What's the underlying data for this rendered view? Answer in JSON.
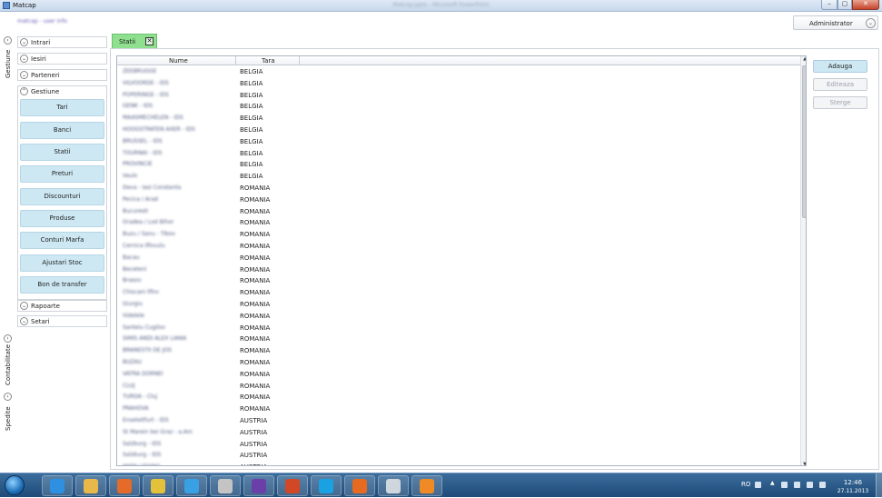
{
  "window": {
    "app_title": "Matcap",
    "center_title": "Matcap.pptx - Microsoft PowerPoint",
    "subtitle": "matcap - user info",
    "min": "–",
    "max": "▢",
    "close": "✕"
  },
  "header": {
    "user_label": "Administrator",
    "user_chevron": "⌄"
  },
  "left_tabs": [
    {
      "label": "Gestiune",
      "chevron": "‹"
    },
    {
      "label": "Contabilitate",
      "chevron": "›"
    },
    {
      "label": "Spedite",
      "chevron": "›"
    }
  ],
  "nav": {
    "sections": [
      {
        "label": "Intrari",
        "chevron": "⌄"
      },
      {
        "label": "Iesiri",
        "chevron": "⌄"
      },
      {
        "label": "Parteneri",
        "chevron": "⌄"
      },
      {
        "label": "Gestiune",
        "chevron": "⌃"
      },
      {
        "label": "Rapoarte",
        "chevron": "⌄"
      },
      {
        "label": "Setari",
        "chevron": "⌄"
      }
    ],
    "gestiune_items": [
      "Tari",
      "Banci",
      "Statii",
      "Preturi",
      "Discounturi",
      "Produse",
      "Conturi Marfa",
      "Ajustari Stoc",
      "Bon de transfer"
    ]
  },
  "tab": {
    "label": "Statii",
    "close": "✕"
  },
  "grid": {
    "columns": [
      "Nume",
      "Tara"
    ],
    "rows": [
      {
        "name": "ZEEBRUGGE",
        "country": "BELGIA"
      },
      {
        "name": "VILVOORDE - IDS",
        "country": "BELGIA"
      },
      {
        "name": "POPERINGE - IDS",
        "country": "BELGIA"
      },
      {
        "name": "GENK - IDS",
        "country": "BELGIA"
      },
      {
        "name": "MAASMECHELEN - IDS",
        "country": "BELGIA"
      },
      {
        "name": "HOOGSTRATEN AXER - IDS",
        "country": "BELGIA"
      },
      {
        "name": "BRUSSEL - IDS",
        "country": "BELGIA"
      },
      {
        "name": "TOURNAI - IDS",
        "country": "BELGIA"
      },
      {
        "name": "PROVINCIE",
        "country": "BELGIA"
      },
      {
        "name": "Vaulx",
        "country": "BELGIA"
      },
      {
        "name": "Deva - Iasi Constanta",
        "country": "ROMANIA"
      },
      {
        "name": "Pecica / Arad",
        "country": "ROMANIA"
      },
      {
        "name": "Bucuresti",
        "country": "ROMANIA"
      },
      {
        "name": "Oradea / Lod Bihor",
        "country": "ROMANIA"
      },
      {
        "name": "Buzu / Sanu - Tibov",
        "country": "ROMANIA"
      },
      {
        "name": "Cernica Ilfovulu",
        "country": "ROMANIA"
      },
      {
        "name": "Bacau",
        "country": "ROMANIA"
      },
      {
        "name": "Beceteni",
        "country": "ROMANIA"
      },
      {
        "name": "Brasov",
        "country": "ROMANIA"
      },
      {
        "name": "Chiscani Ilfov",
        "country": "ROMANIA"
      },
      {
        "name": "Giurgiu",
        "country": "ROMANIA"
      },
      {
        "name": "Videlele",
        "country": "ROMANIA"
      },
      {
        "name": "Santeiu Cugilov",
        "country": "ROMANIA"
      },
      {
        "name": "SIMIS ANDI ALEX LIANA",
        "country": "ROMANIA"
      },
      {
        "name": "BRANESTII DE JOS",
        "country": "ROMANIA"
      },
      {
        "name": "BUZAU",
        "country": "ROMANIA"
      },
      {
        "name": "VATRA DORNEI",
        "country": "ROMANIA"
      },
      {
        "name": "CLUJ",
        "country": "ROMANIA"
      },
      {
        "name": "TURDA - Cluj",
        "country": "ROMANIA"
      },
      {
        "name": "PRAHOVA",
        "country": "ROMANIA"
      },
      {
        "name": "Enseleitfurt - IDS",
        "country": "AUSTRIA"
      },
      {
        "name": "St Marein bei Graz - a.Am",
        "country": "AUSTRIA"
      },
      {
        "name": "Salzburg - IDS",
        "country": "AUSTRIA"
      },
      {
        "name": "Salzburg - IDS",
        "country": "AUSTRIA"
      },
      {
        "name": "WIEN LIESING",
        "country": "AUSTRIA"
      }
    ]
  },
  "actions": {
    "add": "Adauga",
    "edit": "Editeaza",
    "delete": "Sterge"
  },
  "taskbar": {
    "icons": [
      "ie-icon",
      "explorer-icon",
      "media-player-icon",
      "chrome-icon",
      "paint-icon",
      "tools-icon",
      "visual-studio-icon",
      "powerpoint-icon",
      "skype-icon",
      "firefox-icon",
      "calculator-icon",
      "paint-brush-icon"
    ],
    "icon_colors": [
      "#2f8fe0",
      "#e8b94a",
      "#e46b2a",
      "#e3c13b",
      "#3aa0e4",
      "#c4c4c4",
      "#6b3fa8",
      "#d24726",
      "#1aa1e1",
      "#e66a1f",
      "#cfd6de",
      "#f08a24"
    ],
    "tray": {
      "lang": "RO",
      "time": "12:46",
      "date": "27.11.2013"
    }
  }
}
